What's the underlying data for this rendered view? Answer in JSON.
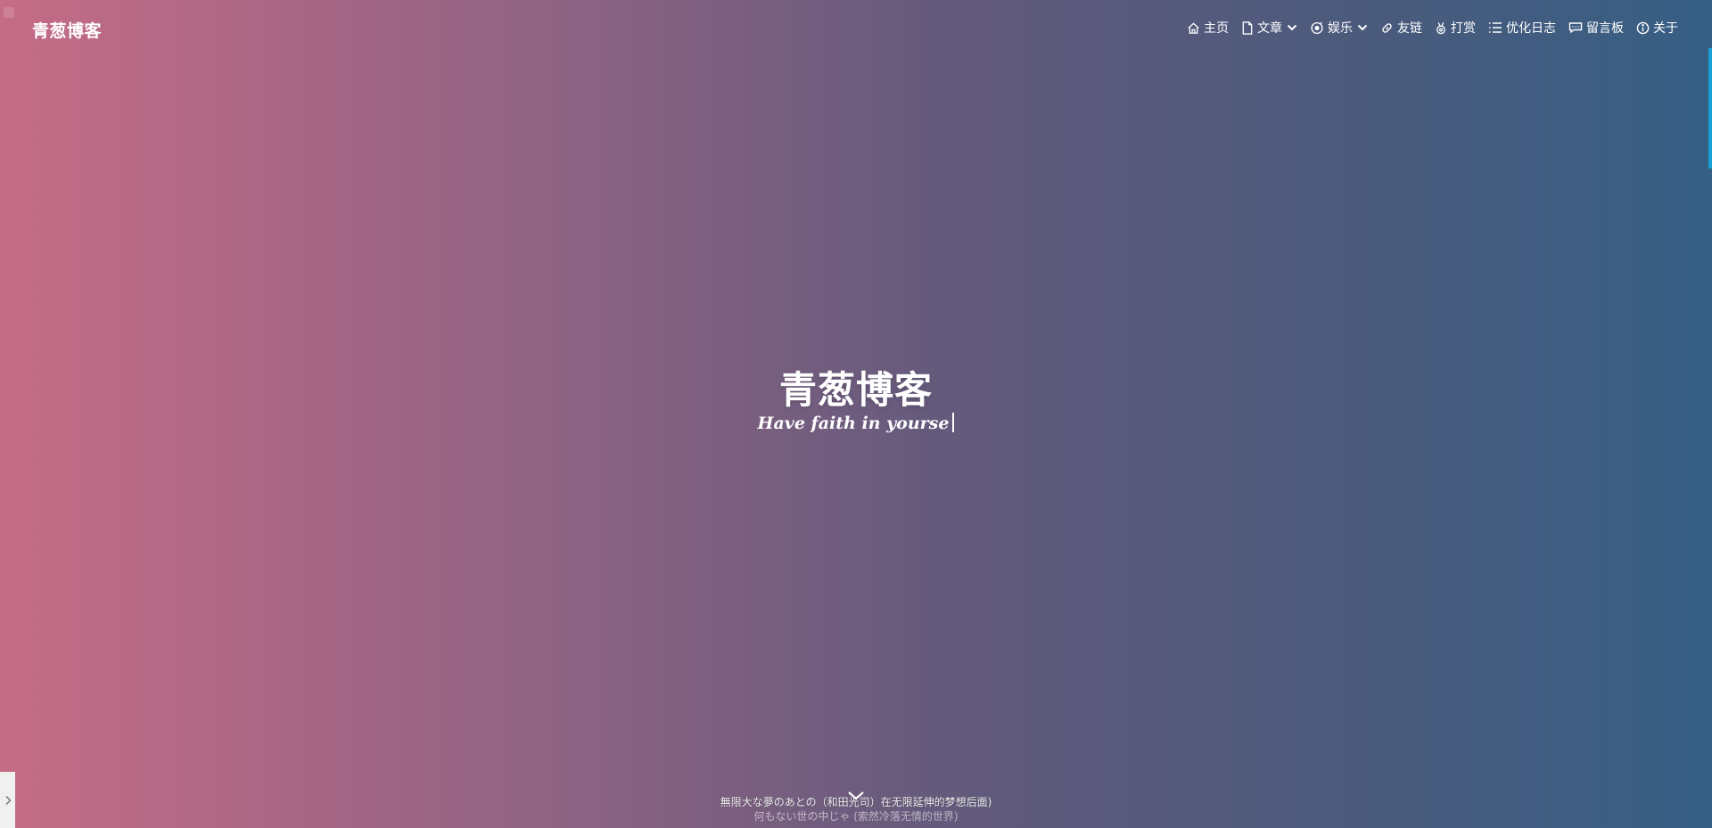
{
  "header": {
    "brand": "青葱博客",
    "nav": [
      {
        "label": "主页",
        "icon": "home-icon"
      },
      {
        "label": "文章",
        "icon": "document-icon",
        "dropdown": true
      },
      {
        "label": "娱乐",
        "icon": "music-disc-icon",
        "dropdown": true
      },
      {
        "label": "友链",
        "icon": "link-icon"
      },
      {
        "label": "打赏",
        "icon": "medal-icon"
      },
      {
        "label": "优化日志",
        "icon": "list-icon"
      },
      {
        "label": "留言板",
        "icon": "message-board-icon"
      },
      {
        "label": "关于",
        "icon": "info-icon"
      }
    ]
  },
  "hero": {
    "title": "青葱博客",
    "subtitle": "Have faith in yourse"
  },
  "footer": {
    "lyric_line1": "無限大な夢のあとの（和田光司）在无限延伸的梦想后面)",
    "lyric_line2": "何もない世の中じゃ (索然冷落无情的世界)"
  },
  "colors": {
    "gradient_left": "#c56c86",
    "gradient_right": "#365f84",
    "accent_edge": "#1a9fd6"
  }
}
